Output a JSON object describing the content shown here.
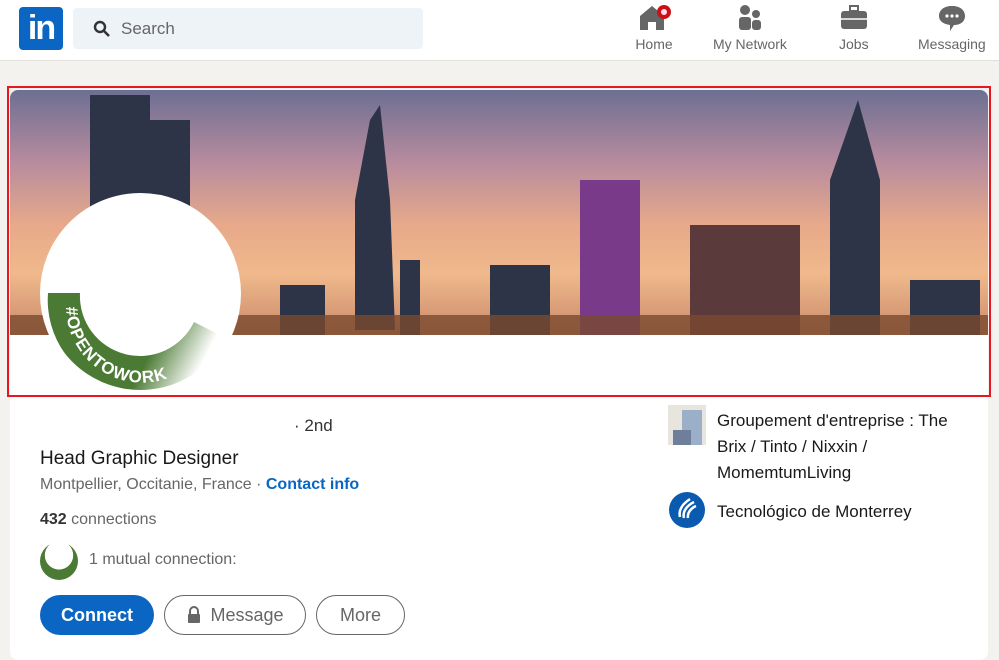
{
  "nav": {
    "logo": "in",
    "search_placeholder": "Search",
    "items": [
      {
        "label": "Home",
        "icon": "home-icon",
        "badge": true
      },
      {
        "label": "My Network",
        "icon": "people-icon"
      },
      {
        "label": "Jobs",
        "icon": "briefcase-icon"
      },
      {
        "label": "Messaging",
        "icon": "chat-icon"
      }
    ]
  },
  "profile": {
    "badge": "#OPENTOWORK",
    "degree": "· 2nd",
    "headline": "Head Graphic Designer",
    "location": "Montpellier, Occitanie, France ·",
    "contact": "Contact info",
    "connections_count": "432",
    "connections_label": "connections",
    "mutual": "1 mutual connection:"
  },
  "experience": [
    {
      "name": "Groupement d'entreprise : The Brix / Tinto / Nixxin / MomemtumLiving"
    },
    {
      "name": "Tecnológico de Monterrey"
    }
  ],
  "actions": {
    "connect": "Connect",
    "message": "Message",
    "more": "More"
  },
  "colors": {
    "brand": "#0a66c2",
    "opentowork": "#4b7a34",
    "highlight": "#e8161e"
  }
}
